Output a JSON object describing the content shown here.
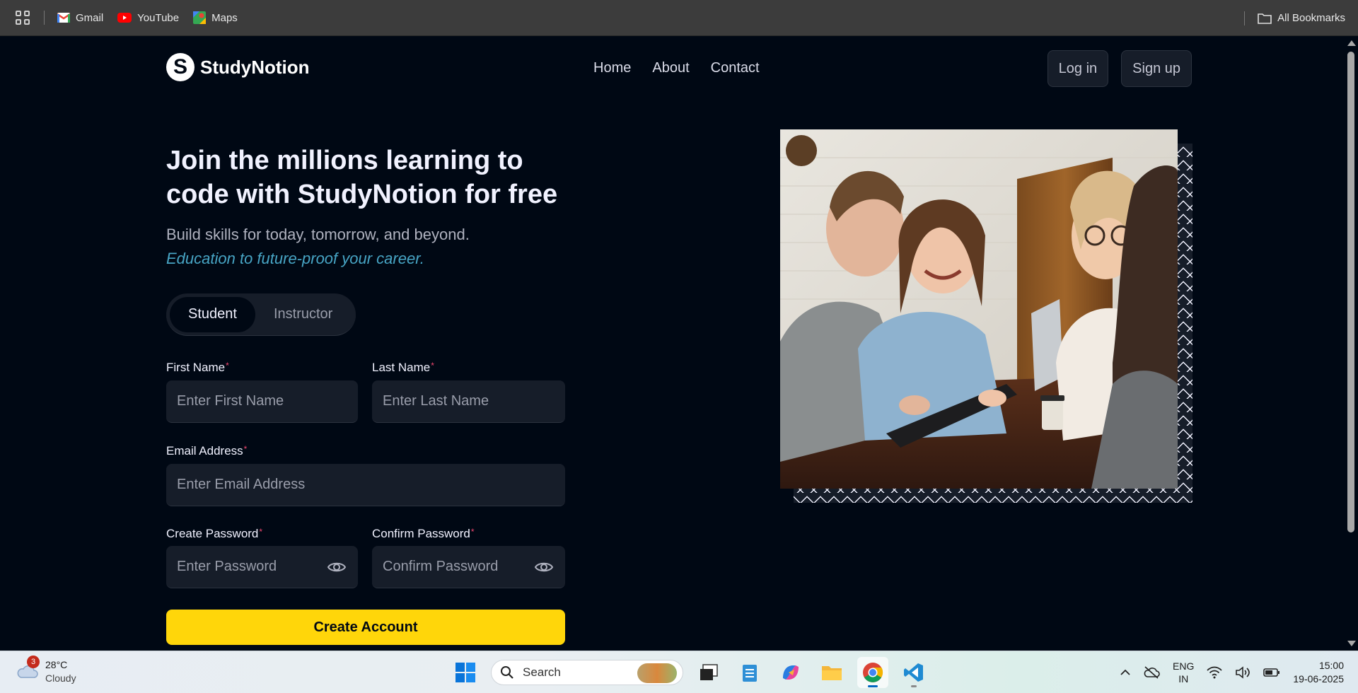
{
  "bookmarks": {
    "items": [
      {
        "label": "Gmail",
        "icon": "gmail-icon"
      },
      {
        "label": "YouTube",
        "icon": "youtube-icon"
      },
      {
        "label": "Maps",
        "icon": "maps-icon"
      }
    ],
    "all_bookmarks": "All Bookmarks"
  },
  "nav": {
    "brand": "StudyNotion",
    "brand_mark": "S",
    "links": [
      "Home",
      "About",
      "Contact"
    ],
    "login": "Log in",
    "signup": "Sign up"
  },
  "hero": {
    "headline": "Join the millions learning to code with StudyNotion for free",
    "subtitle": "Build skills for today, tomorrow, and beyond.",
    "highlight": "Education to future-proof your career."
  },
  "role_toggle": {
    "options": [
      "Student",
      "Instructor"
    ],
    "selected": "Student"
  },
  "form": {
    "first_name": {
      "label": "First Name",
      "placeholder": "Enter First Name",
      "value": ""
    },
    "last_name": {
      "label": "Last Name",
      "placeholder": "Enter Last Name",
      "value": ""
    },
    "email": {
      "label": "Email Address",
      "placeholder": "Enter Email Address",
      "value": ""
    },
    "password": {
      "label": "Create Password",
      "placeholder": "Enter Password",
      "value": ""
    },
    "confirm_password": {
      "label": "Confirm Password",
      "placeholder": "Confirm Password",
      "value": ""
    },
    "required_mark": "*",
    "submit": "Create Account"
  },
  "taskbar": {
    "weather_temp": "28°C",
    "weather_desc": "Cloudy",
    "weather_badge": "3",
    "search_placeholder": "Search",
    "lang_line1": "ENG",
    "lang_line2": "IN",
    "time": "15:00",
    "date": "19-06-2025"
  },
  "colors": {
    "page_bg": "#000814",
    "accent_yellow": "#ffd60a",
    "highlight_blue": "#47a5c5",
    "required_pink": "#ef476f",
    "input_bg": "#161d29"
  }
}
